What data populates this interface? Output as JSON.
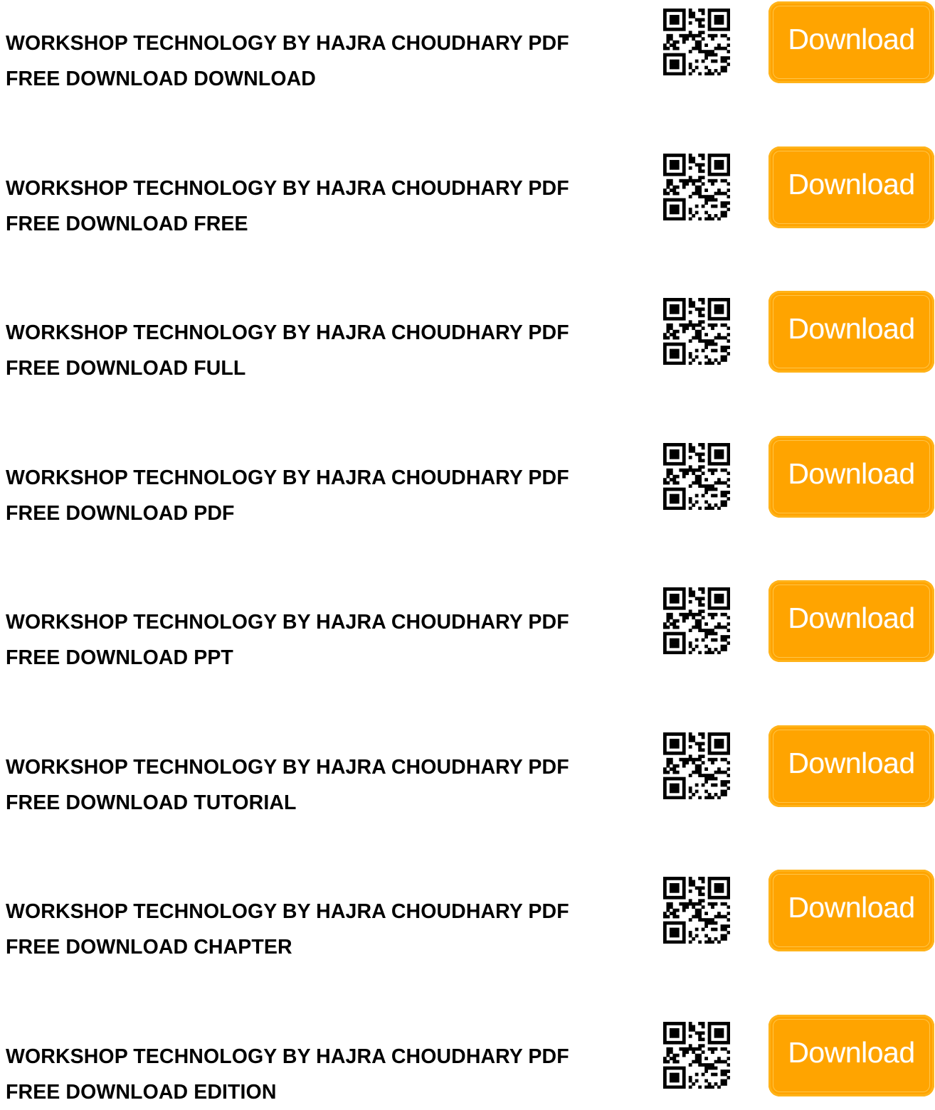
{
  "colors": {
    "button_bg": "#ffa400",
    "button_text": "#ffffff",
    "title_text": "#000000"
  },
  "items": [
    {
      "title_line1": "WORKSHOP TECHNOLOGY BY HAJRA CHOUDHARY PDF",
      "title_line2": "FREE DOWNLOAD DOWNLOAD",
      "button_label": "Download",
      "icon": "qr-code-icon"
    },
    {
      "title_line1": "WORKSHOP TECHNOLOGY BY HAJRA CHOUDHARY PDF",
      "title_line2": "FREE DOWNLOAD FREE",
      "button_label": "Download",
      "icon": "qr-code-icon"
    },
    {
      "title_line1": "WORKSHOP TECHNOLOGY BY HAJRA CHOUDHARY PDF",
      "title_line2": "FREE DOWNLOAD FULL",
      "button_label": "Download",
      "icon": "qr-code-icon"
    },
    {
      "title_line1": "WORKSHOP TECHNOLOGY BY HAJRA CHOUDHARY PDF",
      "title_line2": "FREE DOWNLOAD PDF",
      "button_label": "Download",
      "icon": "qr-code-icon"
    },
    {
      "title_line1": "WORKSHOP TECHNOLOGY BY HAJRA CHOUDHARY PDF",
      "title_line2": "FREE DOWNLOAD PPT",
      "button_label": "Download",
      "icon": "qr-code-icon"
    },
    {
      "title_line1": "WORKSHOP TECHNOLOGY BY HAJRA CHOUDHARY PDF",
      "title_line2": "FREE DOWNLOAD TUTORIAL",
      "button_label": "Download",
      "icon": "qr-code-icon"
    },
    {
      "title_line1": "WORKSHOP TECHNOLOGY BY HAJRA CHOUDHARY PDF",
      "title_line2": "FREE DOWNLOAD CHAPTER",
      "button_label": "Download",
      "icon": "qr-code-icon"
    },
    {
      "title_line1": "WORKSHOP TECHNOLOGY BY HAJRA CHOUDHARY PDF",
      "title_line2": "FREE DOWNLOAD EDITION",
      "button_label": "Download",
      "icon": "qr-code-icon"
    }
  ]
}
